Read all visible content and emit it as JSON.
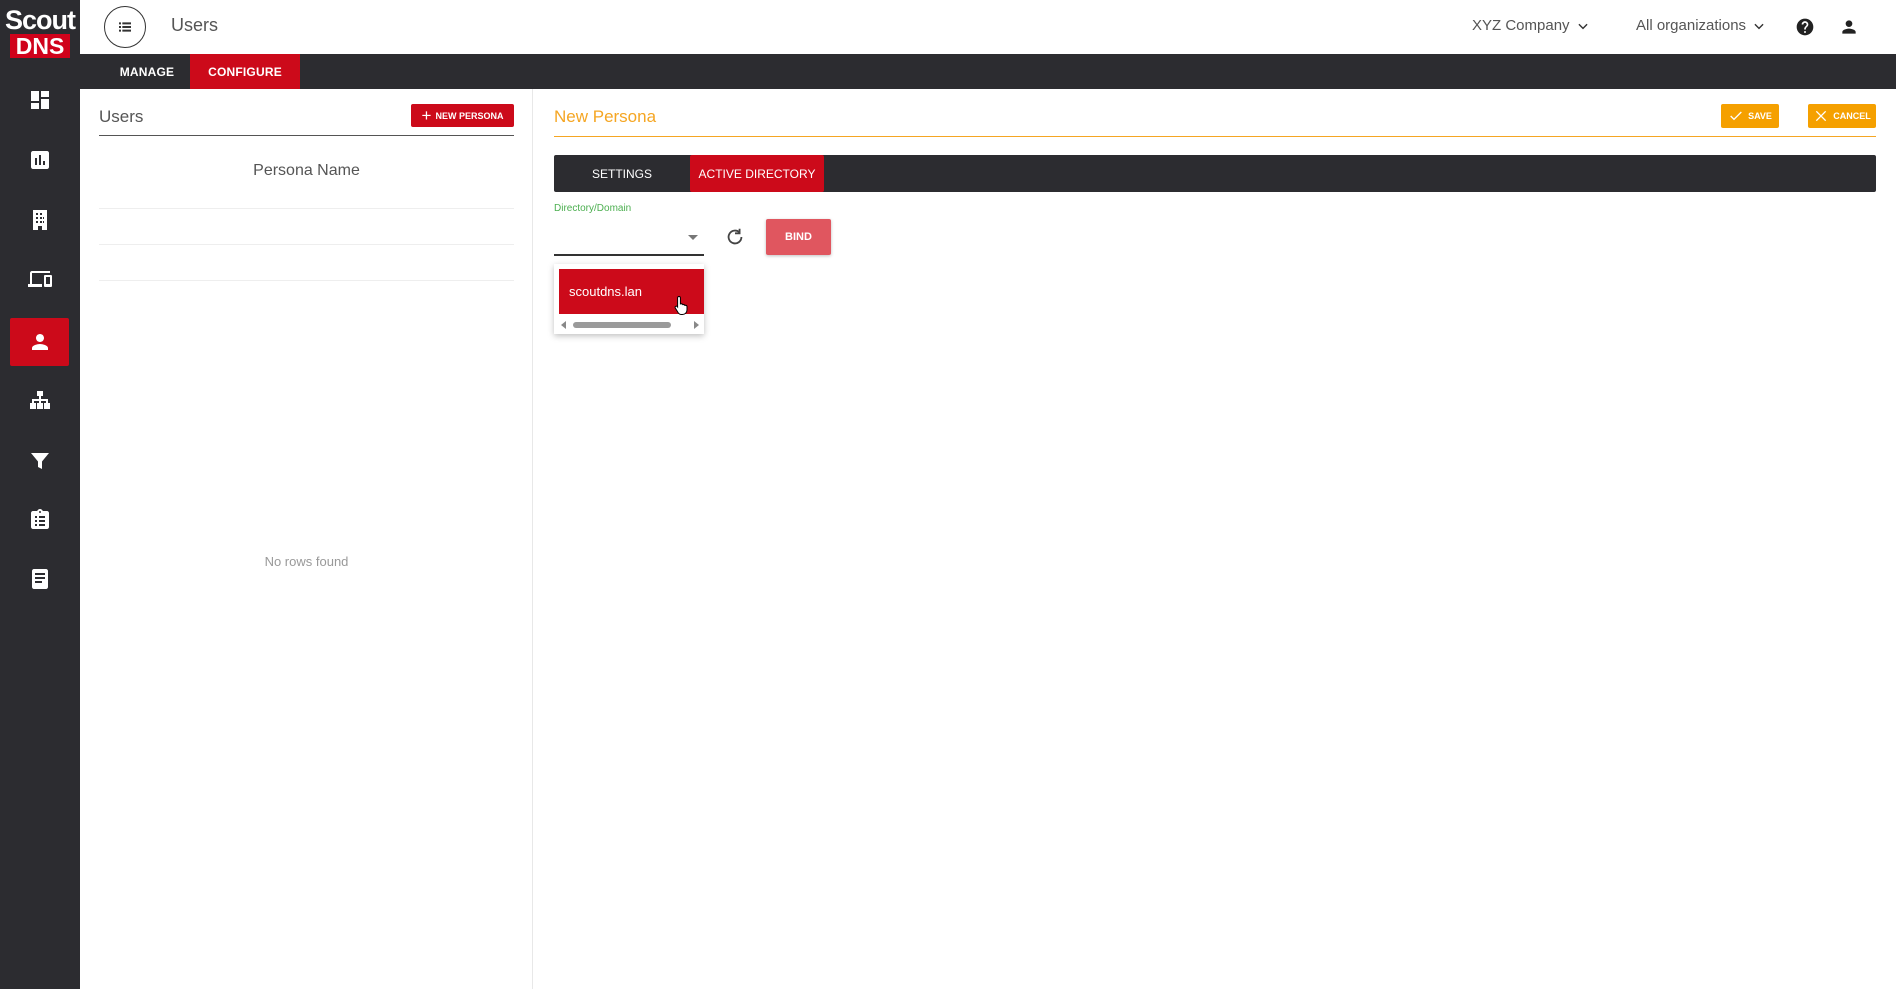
{
  "brand": {
    "line1": "Scout",
    "line2": "DNS"
  },
  "header": {
    "title": "Users",
    "company": "XYZ Company",
    "organization": "All organizations"
  },
  "nav": {
    "tabs": [
      {
        "label": "MANAGE"
      },
      {
        "label": "CONFIGURE"
      }
    ],
    "active": "CONFIGURE"
  },
  "sidebar": {
    "items": [
      {
        "icon": "dashboard-icon"
      },
      {
        "icon": "reports-icon"
      },
      {
        "icon": "building-icon"
      },
      {
        "icon": "devices-icon"
      },
      {
        "icon": "user-icon",
        "active": true
      },
      {
        "icon": "network-icon"
      },
      {
        "icon": "filter-icon"
      },
      {
        "icon": "checklist-icon"
      },
      {
        "icon": "book-icon"
      }
    ]
  },
  "users_panel": {
    "title": "Users",
    "new_button": "NEW PERSONA",
    "column_header": "Persona Name",
    "empty_message": "No rows found"
  },
  "persona": {
    "title": "New Persona",
    "save_label": "SAVE",
    "cancel_label": "CANCEL",
    "tabs": [
      {
        "label": "SETTINGS"
      },
      {
        "label": "ACTIVE DIRECTORY"
      }
    ],
    "active_tab": "ACTIVE DIRECTORY",
    "directory_label": "Directory/Domain",
    "directory_value": "",
    "bind_label": "BIND",
    "dropdown_options": [
      "scoutdns.lan"
    ]
  },
  "colors": {
    "accent_red": "#cc0a1a",
    "accent_orange": "#f5a000",
    "rail_dark": "#2c2c30",
    "label_green": "#4caf50"
  }
}
